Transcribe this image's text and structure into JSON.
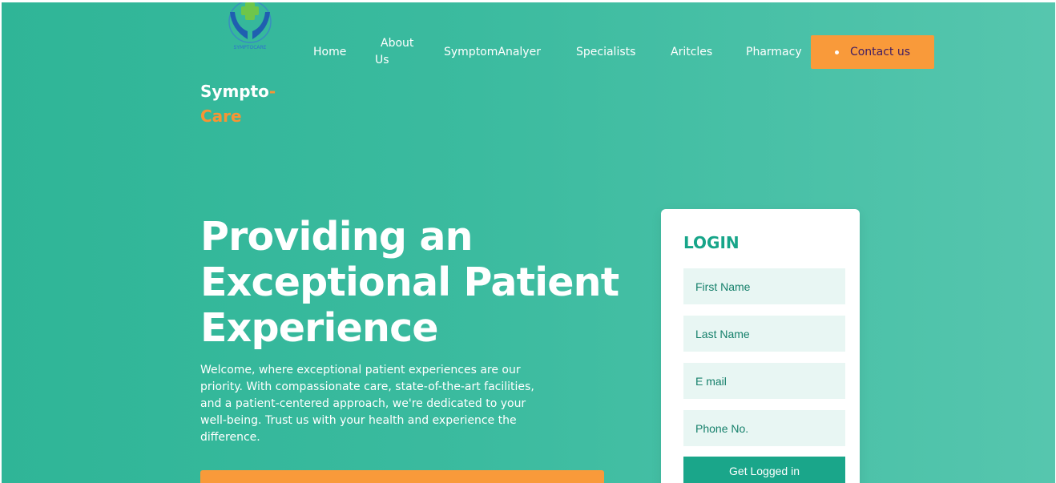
{
  "header": {
    "logo_text": "SYMPTOCARE",
    "nav": [
      {
        "label": "Home"
      },
      {
        "label": "About Us"
      },
      {
        "label": "SymptomAnalyer"
      },
      {
        "label": "Specialists"
      },
      {
        "label": "Aritcles"
      },
      {
        "label": "Pharmacy"
      }
    ],
    "contact_label": "Contact us"
  },
  "brand": {
    "part1": "Sympto",
    "dash": "-",
    "part2": "Care"
  },
  "hero": {
    "title": "Providing an Exceptional Patient Experience",
    "description": "Welcome, where exceptional patient experiences are our priority. With compassionate care, state-of-the-art facilities, and a patient-centered approach, we're dedicated to your well-being. Trust us with your health and experience the difference."
  },
  "login": {
    "title": "LOGIN",
    "fields": [
      {
        "placeholder": "First Name"
      },
      {
        "placeholder": "Last Name"
      },
      {
        "placeholder": "E mail"
      },
      {
        "placeholder": "Phone No."
      }
    ],
    "submit_label": "Get Logged in"
  },
  "colors": {
    "background": "#3bbb9f",
    "accent_orange": "#f99a3a",
    "brand_orange": "#f79434",
    "login_green": "#17a589",
    "field_bg": "#e8f6f3"
  }
}
